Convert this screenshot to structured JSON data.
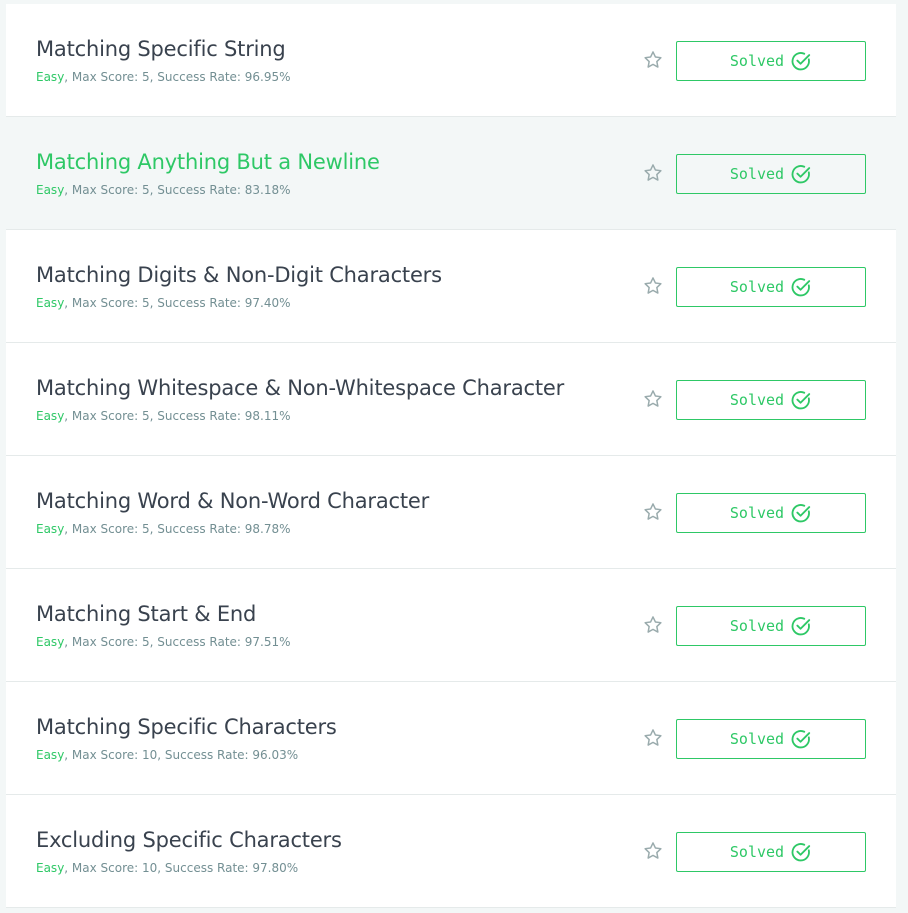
{
  "challenges": [
    {
      "title": "Matching Specific String",
      "difficulty": "Easy",
      "details": ", Max Score: 5, Success Rate: 96.95%",
      "status": "Solved",
      "hover": false
    },
    {
      "title": "Matching Anything But a Newline",
      "difficulty": "Easy",
      "details": ", Max Score: 5, Success Rate: 83.18%",
      "status": "Solved",
      "hover": true
    },
    {
      "title": "Matching Digits & Non-Digit Characters",
      "difficulty": "Easy",
      "details": ", Max Score: 5, Success Rate: 97.40%",
      "status": "Solved",
      "hover": false
    },
    {
      "title": "Matching Whitespace & Non-Whitespace Character",
      "difficulty": "Easy",
      "details": ", Max Score: 5, Success Rate: 98.11%",
      "status": "Solved",
      "hover": false
    },
    {
      "title": "Matching Word & Non-Word Character",
      "difficulty": "Easy",
      "details": ", Max Score: 5, Success Rate: 98.78%",
      "status": "Solved",
      "hover": false
    },
    {
      "title": "Matching Start & End",
      "difficulty": "Easy",
      "details": ", Max Score: 5, Success Rate: 97.51%",
      "status": "Solved",
      "hover": false
    },
    {
      "title": "Matching Specific Characters",
      "difficulty": "Easy",
      "details": ", Max Score: 10, Success Rate: 96.03%",
      "status": "Solved",
      "hover": false
    },
    {
      "title": "Excluding Specific Characters",
      "difficulty": "Easy",
      "details": ", Max Score: 10, Success Rate: 97.80%",
      "status": "Solved",
      "hover": false
    }
  ],
  "icons": {
    "favorite": "star-outline-icon",
    "solved": "check-circle-icon"
  },
  "colors": {
    "accent": "#2ec866",
    "title": "#39424e",
    "meta": "#738f93",
    "hover_bg": "#f3f7f7",
    "star": "#9aabad"
  }
}
